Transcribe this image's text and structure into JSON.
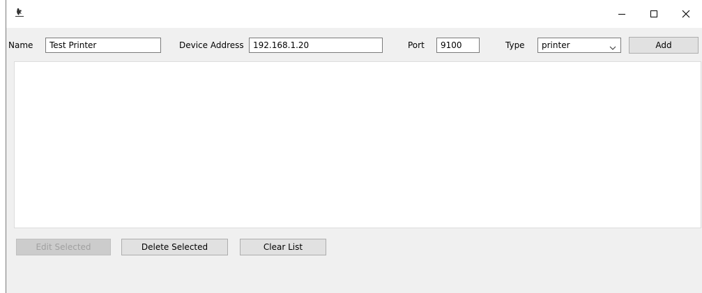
{
  "window": {
    "title": "",
    "controls": {
      "minimize_icon": "minimize-icon",
      "maximize_icon": "maximize-icon",
      "close_icon": "close-icon"
    }
  },
  "form": {
    "name_label": "Name",
    "name_value": "Test Printer",
    "address_label": "Device Address",
    "address_value": "192.168.1.20",
    "port_label": "Port",
    "port_value": "9100",
    "type_label": "Type",
    "type_value": "printer",
    "add_label": "Add"
  },
  "list": {
    "items": []
  },
  "actions": {
    "edit_label": "Edit Selected",
    "delete_label": "Delete Selected",
    "clear_label": "Clear List"
  },
  "colors": {
    "window_bg": "#f0f0f0",
    "titlebar_bg": "#ffffff",
    "button_bg": "#e1e1e1",
    "disabled_text": "#a0a0a0"
  }
}
